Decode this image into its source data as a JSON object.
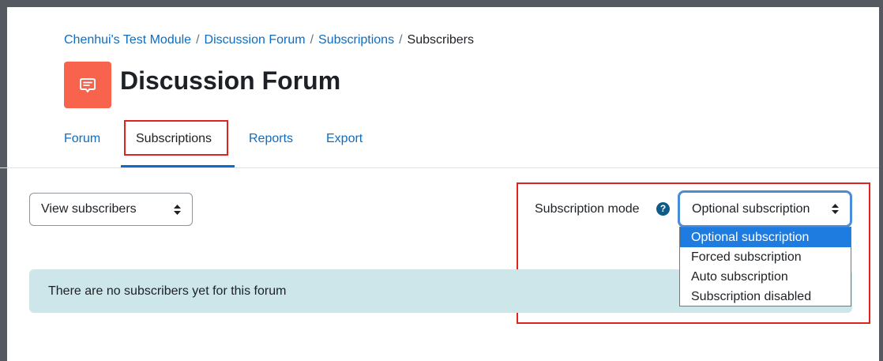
{
  "breadcrumb": {
    "items": [
      "Chenhui's Test Module",
      "Discussion Forum",
      "Subscriptions"
    ],
    "separator": "/",
    "current": "Subscribers"
  },
  "header": {
    "title": "Discussion Forum",
    "icon": "forum-chat-icon"
  },
  "tabs": [
    {
      "label": "Forum"
    },
    {
      "label": "Subscriptions"
    },
    {
      "label": "Reports"
    },
    {
      "label": "Export"
    }
  ],
  "active_tab": "Subscriptions",
  "view_select": {
    "value": "View subscribers"
  },
  "subscription_mode": {
    "label": "Subscription mode",
    "help_glyph": "?",
    "value": "Optional subscription",
    "options": [
      "Optional subscription",
      "Forced subscription",
      "Auto subscription",
      "Subscription disabled"
    ],
    "selected_index": 0
  },
  "alert": {
    "message": "There are no subscribers yet for this forum"
  },
  "colors": {
    "link": "#0f6cbf",
    "forum_icon_bg": "#f7634d",
    "highlight": "#e0231f",
    "selected_option": "#1e7be0",
    "alert_bg": "#cce6ea"
  }
}
